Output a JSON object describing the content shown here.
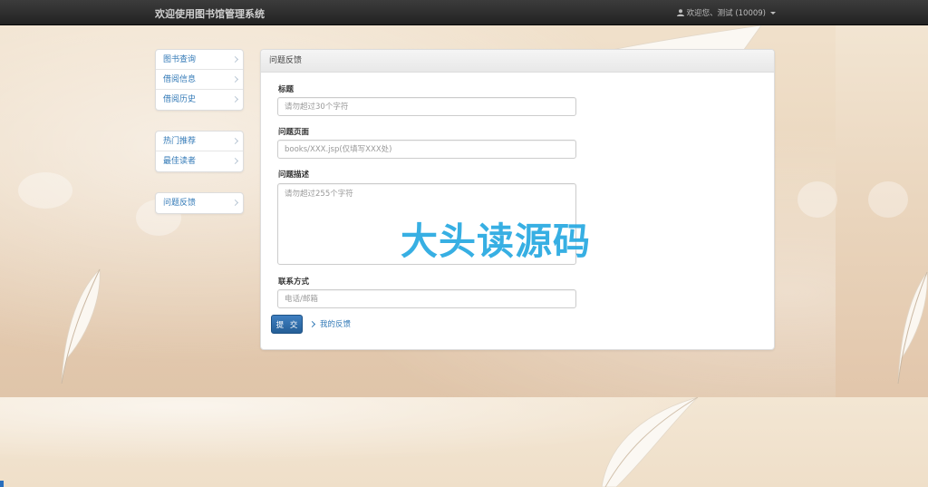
{
  "navbar": {
    "brand": "欢迎使用图书馆管理系统",
    "user_label": "欢迎您、测试 (10009)"
  },
  "sidebar": {
    "group1": [
      {
        "label": "图书查询"
      },
      {
        "label": "借阅信息"
      },
      {
        "label": "借阅历史"
      }
    ],
    "group2": [
      {
        "label": "热门推荐"
      },
      {
        "label": "最佳读者"
      }
    ],
    "group3": [
      {
        "label": "问题反馈"
      }
    ]
  },
  "panel": {
    "heading": "问题反馈",
    "fields": {
      "title_label": "标题",
      "title_placeholder": "请勿超过30个字符",
      "page_label": "问题页面",
      "page_placeholder": "books/XXX.jsp(仅填写XXX处)",
      "desc_label": "问题描述",
      "desc_placeholder": "请勿超过255个字符",
      "contact_label": "联系方式",
      "contact_placeholder": "电话/邮箱"
    },
    "submit_label": "提 交",
    "my_feedback_label": "我的反馈"
  },
  "watermark": "大头读源码",
  "colors": {
    "navbar": "#222222",
    "link": "#337ab7",
    "primary_button": "#2e6da4",
    "watermark": "#27a9e1"
  }
}
